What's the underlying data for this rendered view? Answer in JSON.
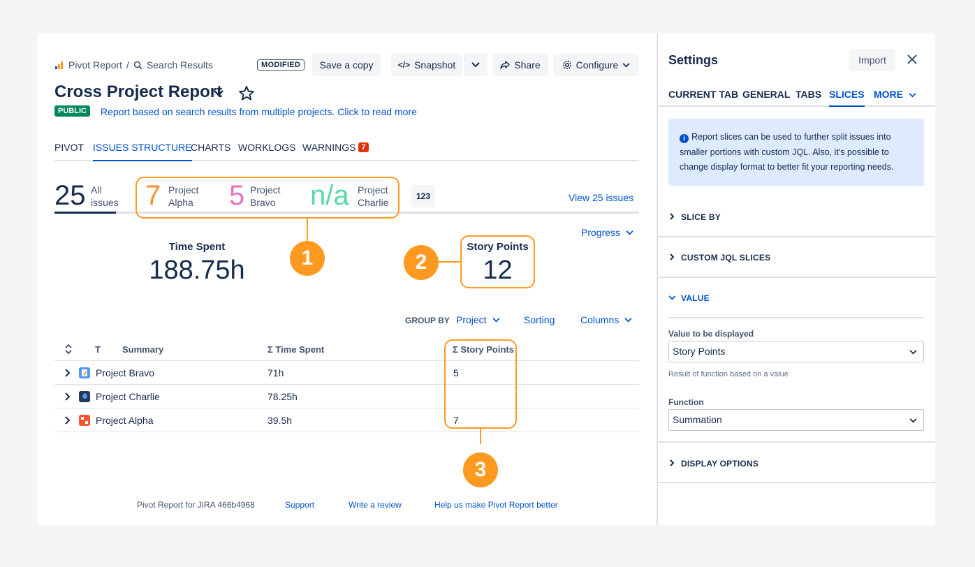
{
  "breadcrumb": {
    "app": "Pivot Report",
    "separator": "/",
    "page": "Search Results"
  },
  "header": {
    "modified_badge": "MODIFIED",
    "save_copy": "Save a copy",
    "snapshot": "Snapshot",
    "share": "Share",
    "configure": "Configure"
  },
  "report": {
    "title": "Cross Project Report",
    "visibility": "PUBLIC",
    "description": "Report based on search results from multiple projects. Click to read more"
  },
  "tabs": [
    {
      "label": "PIVOT"
    },
    {
      "label": "ISSUES STRUCTURE",
      "active": true
    },
    {
      "label": "CHARTS"
    },
    {
      "label": "WORKLOGS"
    },
    {
      "label": "WARNINGS",
      "badge": "7"
    }
  ],
  "summary": {
    "total": {
      "value": "25",
      "label_line1": "All",
      "label_line2": "issues"
    },
    "projects": [
      {
        "value": "7",
        "line1": "Project",
        "line2": "Alpha",
        "color": "#f79233"
      },
      {
        "value": "5",
        "line1": "Project",
        "line2": "Bravo",
        "color": "#e774bb"
      },
      {
        "value": "n/a",
        "line1": "Project",
        "line2": "Charlie",
        "color": "#57d9a3"
      }
    ],
    "number_format_icon": "123",
    "view_issues": "View 25 issues"
  },
  "progress_dropdown": "Progress",
  "metrics": {
    "time_spent": {
      "label": "Time Spent",
      "value": "188.75h"
    },
    "story_points": {
      "label": "Story Points",
      "value": "12"
    }
  },
  "callouts": [
    "1",
    "2",
    "3"
  ],
  "toolbar": {
    "group_by_label": "GROUP BY",
    "group_by_value": "Project",
    "sorting": "Sorting",
    "columns": "Columns"
  },
  "table": {
    "headers": {
      "type": "T",
      "summary": "Summary",
      "time_spent": "Σ Time Spent",
      "story_points": "Σ Story Points"
    },
    "rows": [
      {
        "name": "Project Bravo",
        "time": "71h",
        "points": "5",
        "icon_color": "#4c9aff",
        "icon": "notepad-icon"
      },
      {
        "name": "Project Charlie",
        "time": "78.25h",
        "points": "",
        "icon_color": "#253858",
        "icon": "rocket-icon"
      },
      {
        "name": "Project Alpha",
        "time": "39.5h",
        "points": "7",
        "icon_color": "#ff5630",
        "icon": "puzzle-icon"
      }
    ]
  },
  "footer": {
    "version": "Pivot Report for JIRA 466b4968",
    "support": "Support",
    "review": "Write a review",
    "feedback": "Help us make Pivot Report better"
  },
  "settings": {
    "title": "Settings",
    "import": "Import",
    "tabs": [
      {
        "label": "CURRENT TAB"
      },
      {
        "label": "GENERAL"
      },
      {
        "label": "TABS"
      },
      {
        "label": "SLICES",
        "active": true
      },
      {
        "label": "MORE"
      }
    ],
    "info": "Report slices can be used to further split issues into smaller portions with custom JQL. Also, it's possible to change display format to better fit your reporting needs.",
    "sections": {
      "slice_by": "SLICE BY",
      "custom_jql": "CUSTOM JQL SLICES",
      "value": "VALUE",
      "display_options": "DISPLAY OPTIONS"
    },
    "value_field": {
      "label": "Value to be displayed",
      "selected": "Story Points",
      "helper": "Result of function based on a value"
    },
    "function_field": {
      "label": "Function",
      "selected": "Summation"
    }
  },
  "colors": {
    "accent": "#0052cc",
    "highlight": "#ff991f",
    "public": "#00875a",
    "warning": "#de350b"
  }
}
